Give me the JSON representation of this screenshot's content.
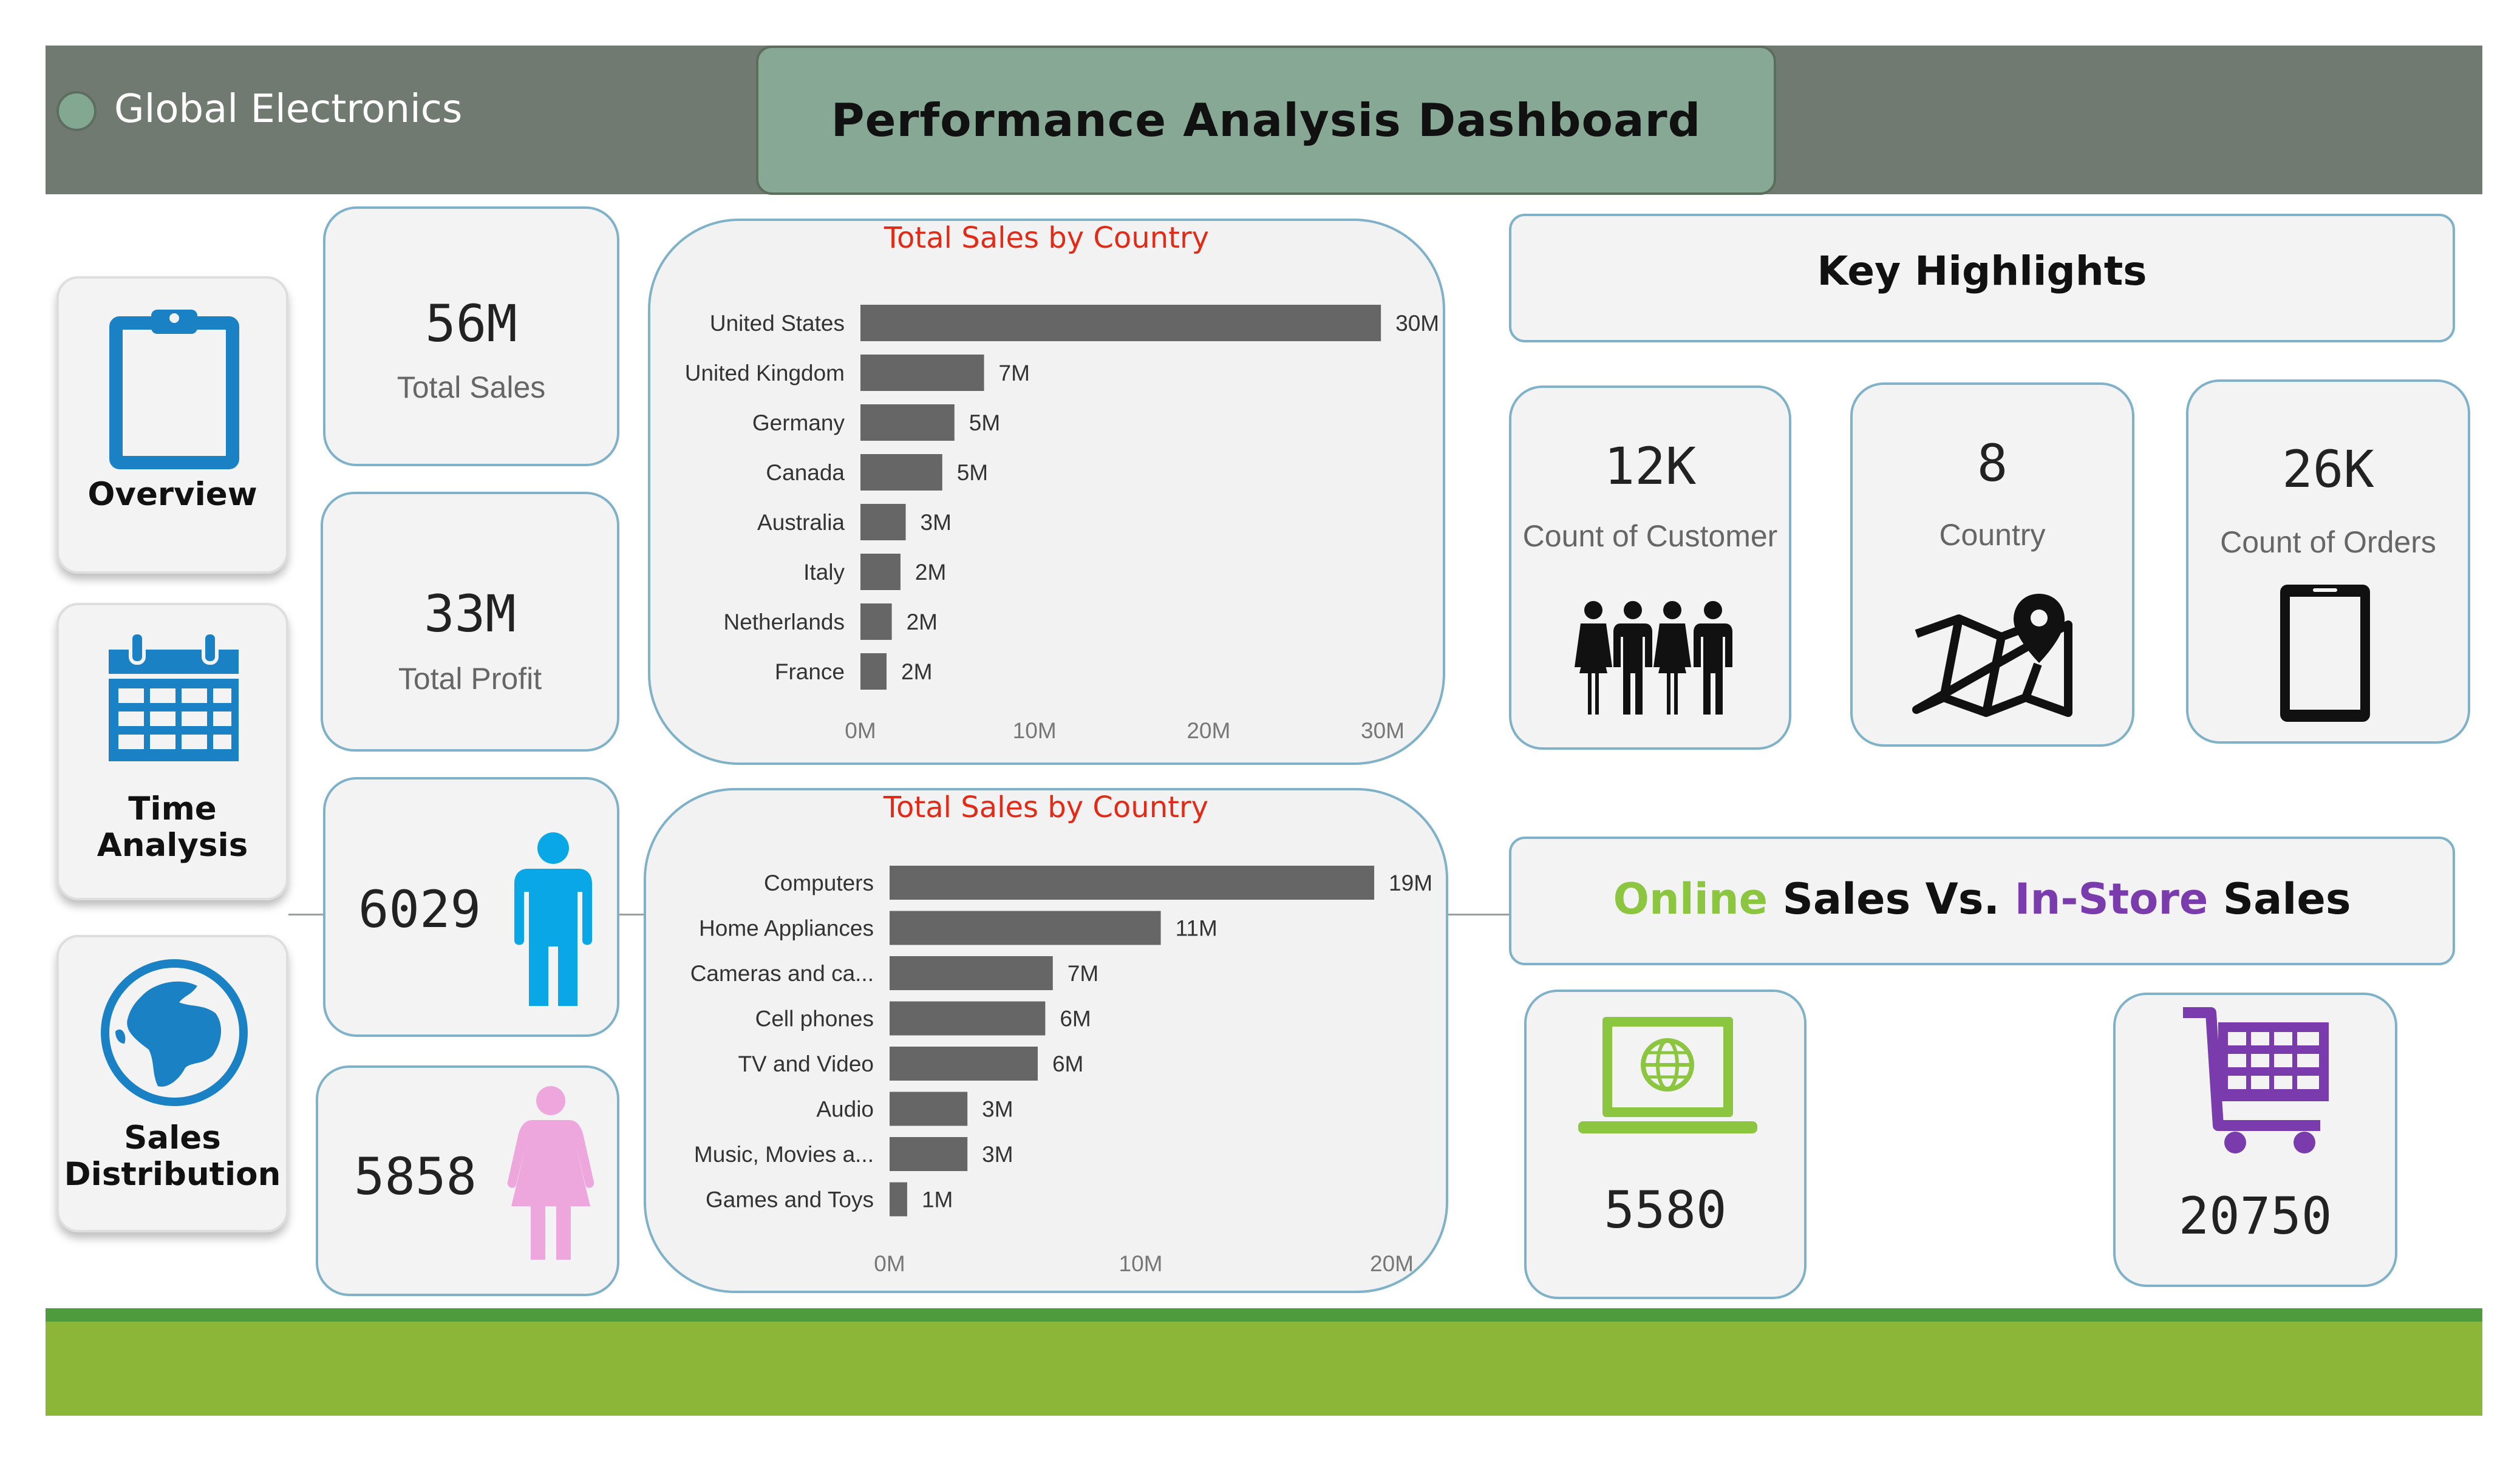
{
  "header": {
    "brand": "Global Electronics",
    "title": "Performance Analysis Dashboard"
  },
  "nav": {
    "overview": "Overview",
    "time_analysis_line1": "Time",
    "time_analysis_line2": "Analysis",
    "sales_distribution_line1": "Sales",
    "sales_distribution_line2": "Distribution"
  },
  "kpis": {
    "total_sales": {
      "value": "56M",
      "label": "Total Sales"
    },
    "total_profit": {
      "value": "33M",
      "label": "Total Profit"
    },
    "male": {
      "value": "6029"
    },
    "female": {
      "value": "5858"
    }
  },
  "highlights": {
    "title": "Key Highlights",
    "customers": {
      "value": "12K",
      "label": "Count of Customer"
    },
    "country": {
      "value": "8",
      "label": "Country"
    },
    "orders": {
      "value": "26K",
      "label": "Count of Orders"
    }
  },
  "online_vs_store": {
    "online": "Online",
    "sales1": " Sales Vs. ",
    "instore": "In-Store",
    "sales2": " Sales",
    "online_value": "5580",
    "instore_value": "20750"
  },
  "colors": {
    "bar": "#666666",
    "chart_title": "#e32a16",
    "accent_blue": "#1d78b4",
    "male": "#0aa7e6",
    "female": "#eda7dd",
    "online_green": "#8cc540",
    "instore_purple": "#7a3cad"
  },
  "chart_data": [
    {
      "type": "bar",
      "orientation": "horizontal",
      "title": "Total Sales by Country",
      "categories": [
        "United States",
        "United Kingdom",
        "Germany",
        "Canada",
        "Australia",
        "Italy",
        "Netherlands",
        "France"
      ],
      "values": [
        29.9,
        7.1,
        5.4,
        4.7,
        2.6,
        2.3,
        1.8,
        1.5
      ],
      "data_labels": [
        "30M",
        "7M",
        "5M",
        "5M",
        "3M",
        "2M",
        "2M",
        "2M"
      ],
      "xticks": [
        "0M",
        "10M",
        "20M",
        "30M"
      ],
      "xlim": [
        0,
        30
      ],
      "grid": false
    },
    {
      "type": "bar",
      "orientation": "horizontal",
      "title": "Total Sales by Country",
      "categories": [
        "Computers",
        "Home Appliances",
        "Cameras and ca...",
        "Cell phones",
        "TV and Video",
        "Audio",
        "Music, Movies a...",
        "Games and Toys"
      ],
      "values": [
        19.3,
        10.8,
        6.5,
        6.2,
        5.9,
        3.1,
        3.1,
        0.7
      ],
      "data_labels": [
        "19M",
        "11M",
        "7M",
        "6M",
        "6M",
        "3M",
        "3M",
        "1M"
      ],
      "xticks": [
        "0M",
        "10M",
        "20M"
      ],
      "xlim": [
        0,
        20
      ],
      "grid": false
    }
  ]
}
